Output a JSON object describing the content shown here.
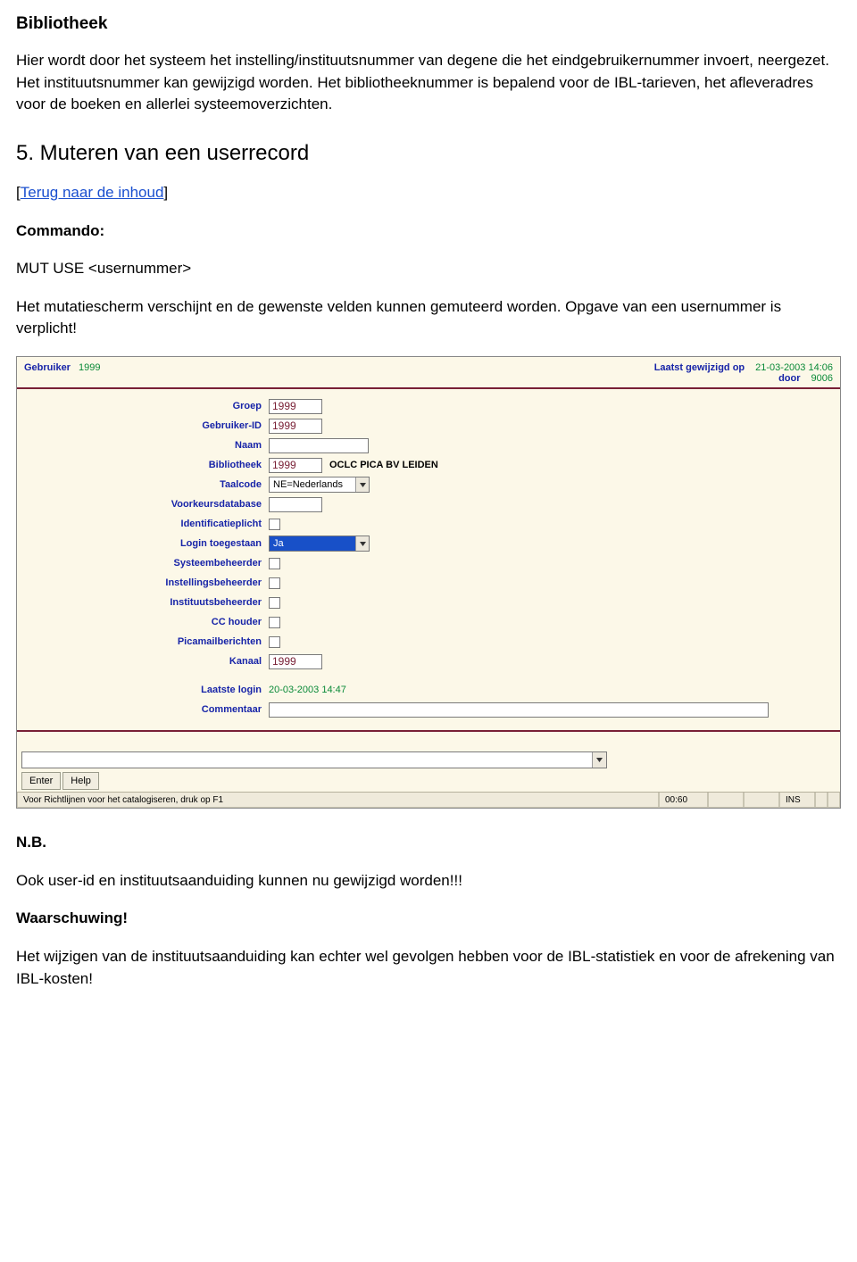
{
  "doc": {
    "section_title": "Bibliotheek",
    "para1": "Hier wordt door het systeem het instelling/instituutsnummer van degene die het eindgebruikernummer invoert, neergezet. Het instituutsnummer kan gewijzigd worden. Het bibliotheeknummer is bepalend voor de IBL-tarieven, het afleveradres voor de boeken en allerlei systeemoverzichten.",
    "heading5": "5. Muteren van een userrecord",
    "back_link": "Terug naar de inhoud",
    "commando": "Commando:",
    "cmd_line": "MUT USE <usernummer>",
    "para2": "Het mutatiescherm verschijnt en de gewenste velden kunnen gemuteerd worden. Opgave van een usernummer is verplicht!",
    "nb": "N.B.",
    "nb_line": "Ook user-id en instituutsaanduiding kunnen nu gewijzigd worden!!!",
    "warn": "Waarschuwing!",
    "warn_line": "Het wijzigen van de instituutsaanduiding kan echter wel gevolgen hebben voor de IBL-statistiek en voor de afrekening van IBL-kosten!"
  },
  "ui": {
    "top": {
      "gebruiker_label": "Gebruiker",
      "gebruiker_value": "1999",
      "laatst_label": "Laatst gewijzigd op",
      "laatst_value": "21-03-2003 14:06",
      "door_label": "door",
      "door_value": "9006"
    },
    "fields": {
      "groep": {
        "label": "Groep",
        "value": "1999"
      },
      "gebruiker_id": {
        "label": "Gebruiker-ID",
        "value": "1999"
      },
      "naam": {
        "label": "Naam",
        "value": ""
      },
      "bibliotheek": {
        "label": "Bibliotheek",
        "value": "1999",
        "extra": "OCLC PICA BV LEIDEN"
      },
      "taalcode": {
        "label": "Taalcode",
        "value": "NE=Nederlands"
      },
      "voorkeur": {
        "label": "Voorkeursdatabase",
        "value": ""
      },
      "ident": {
        "label": "Identificatieplicht"
      },
      "login": {
        "label": "Login toegestaan",
        "value": "Ja"
      },
      "sys": {
        "label": "Systeembeheerder"
      },
      "instell": {
        "label": "Instellingsbeheerder"
      },
      "instituut": {
        "label": "Instituutsbeheerder"
      },
      "cc": {
        "label": "CC houder"
      },
      "pica": {
        "label": "Picamailberichten"
      },
      "kanaal": {
        "label": "Kanaal",
        "value": "1999"
      },
      "laatste_login": {
        "label": "Laatste login",
        "value": "20-03-2003 14:47"
      },
      "commentaar": {
        "label": "Commentaar",
        "value": ""
      }
    },
    "buttons": {
      "enter": "Enter",
      "help": "Help"
    },
    "status": {
      "hint": "Voor Richtlijnen voor het catalogiseren, druk op F1",
      "time": "00:60",
      "ins": "INS"
    }
  }
}
